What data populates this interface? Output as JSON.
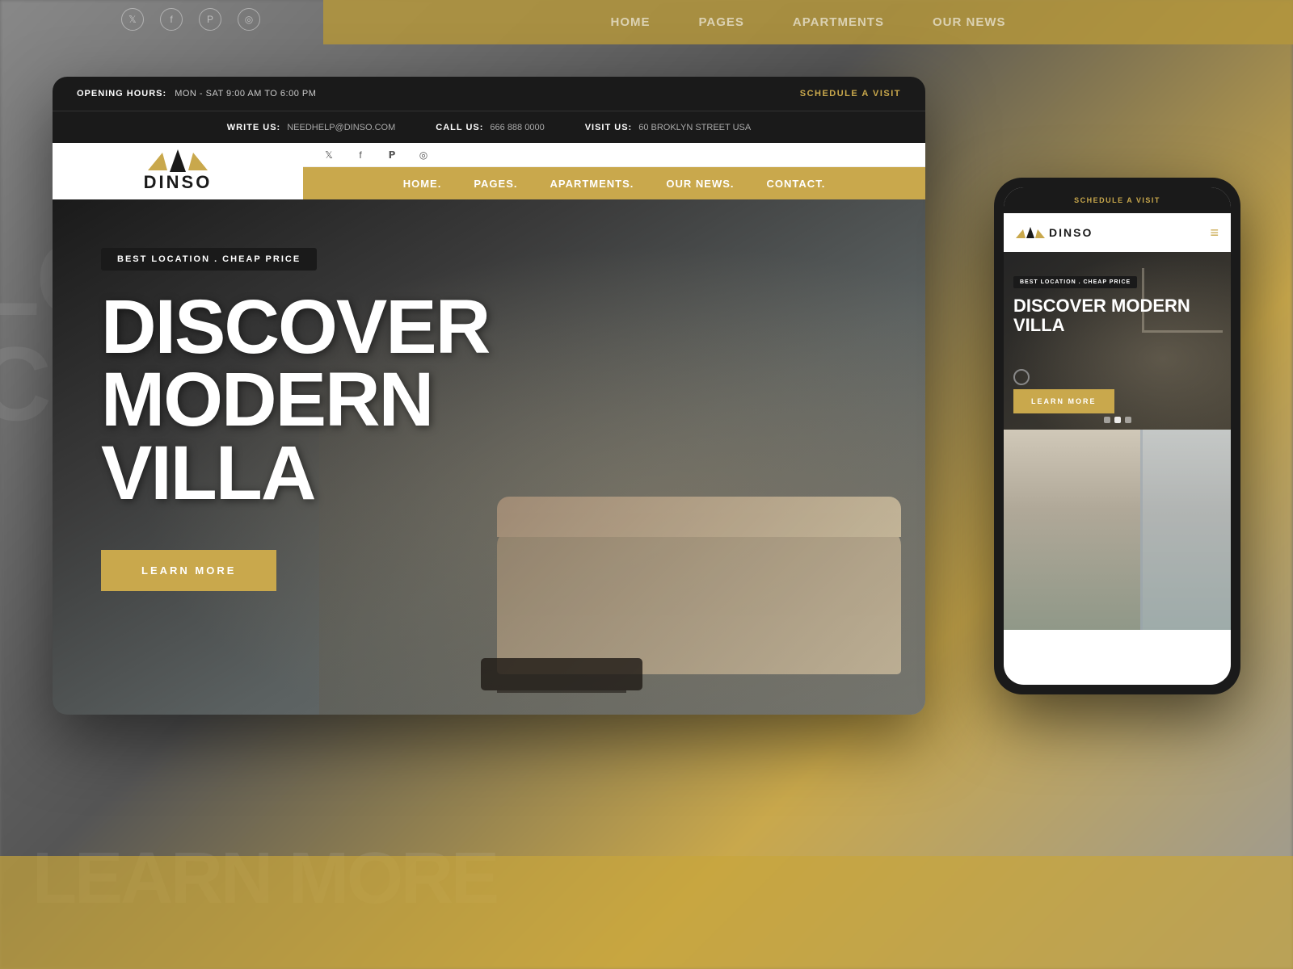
{
  "site": {
    "name": "DINSO",
    "tagline": "BEST LOCATION . CHEAP PRICE",
    "hero_title_line1": "DISCOVER",
    "hero_title_line2": "MODERN",
    "hero_title_line3": "VILLA",
    "cta_label": "LEARN MORE",
    "mobile_hero_title": "DISCOVER MODERN VILLA"
  },
  "header": {
    "opening_label": "OPENING HOURS:",
    "opening_hours": "MON - SAT 9:00 AM TO 6:00 PM",
    "schedule_label": "SCHEDULE A VISIT",
    "write_label": "WRITE US:",
    "email": "NEEDHELP@DINSO.COM",
    "call_label": "CALL US:",
    "phone": "666 888 0000",
    "visit_label": "VISIT US:",
    "address": "60 BROKLYN STREET USA"
  },
  "nav": {
    "items": [
      {
        "label": "HOME."
      },
      {
        "label": "PAGES."
      },
      {
        "label": "APARTMENTS."
      },
      {
        "label": "OUR NEWS."
      },
      {
        "label": "CONTACT."
      }
    ]
  },
  "bg_nav": {
    "items": [
      {
        "label": "HOME"
      },
      {
        "label": "PAGES"
      },
      {
        "label": "APARTMENTS"
      },
      {
        "label": "OUR NEWS"
      }
    ]
  },
  "social": {
    "icons": [
      "𝕏",
      "f",
      "𝗣",
      "📷"
    ]
  },
  "colors": {
    "gold": "#c9a84c",
    "dark": "#1a1a1a",
    "white": "#ffffff"
  }
}
